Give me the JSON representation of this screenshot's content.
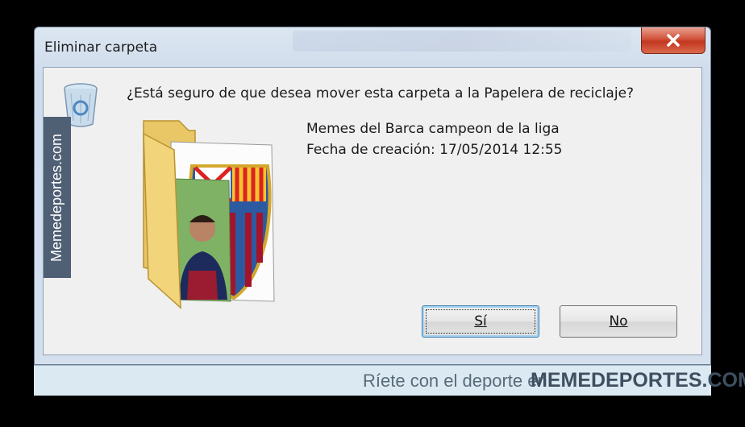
{
  "dialog": {
    "title": "Eliminar carpeta",
    "close_icon": "close-icon",
    "question": "¿Está seguro de que desea mover esta carpeta a la Papelera de reciclaje?",
    "folder_name": "Memes del Barca campeon de la liga",
    "created": "Fecha de creación: 17/05/2014 12:55",
    "yes_label": "Sí",
    "no_label": "No",
    "icon": "recycle-bin-icon"
  },
  "watermark": {
    "side_text": "Memedeportes.com",
    "footer_left": "Ríete con el deporte en",
    "footer_right": "MEMEDEPORTES.COM"
  },
  "colors": {
    "close_button": "#c2371f",
    "accent_focus": "#3c7fb1"
  }
}
